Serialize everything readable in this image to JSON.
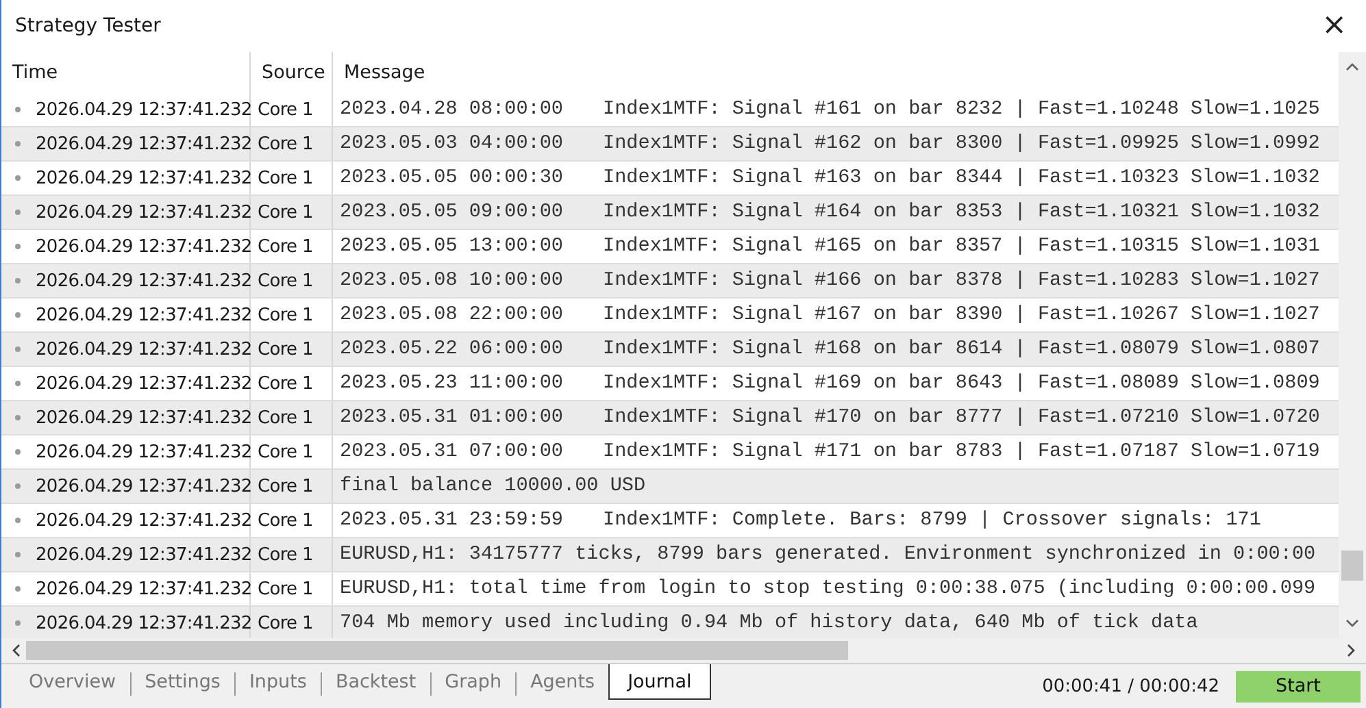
{
  "window": {
    "title": "Strategy Tester",
    "close": "×"
  },
  "table": {
    "columns": [
      "Time",
      "Source",
      "Message"
    ],
    "rows": [
      {
        "time": "2026.04.29 12:37:41.232",
        "source": "Core 1",
        "date": "2023.04.28 08:00:00",
        "text": "Index1MTF: Signal #161 on bar 8232 | Fast=1.10248 Slow=1.1025"
      },
      {
        "time": "2026.04.29 12:37:41.232",
        "source": "Core 1",
        "date": "2023.05.03 04:00:00",
        "text": "Index1MTF: Signal #162 on bar 8300 | Fast=1.09925 Slow=1.0992"
      },
      {
        "time": "2026.04.29 12:37:41.232",
        "source": "Core 1",
        "date": "2023.05.05 00:00:30",
        "text": "Index1MTF: Signal #163 on bar 8344 | Fast=1.10323 Slow=1.1032"
      },
      {
        "time": "2026.04.29 12:37:41.232",
        "source": "Core 1",
        "date": "2023.05.05 09:00:00",
        "text": "Index1MTF: Signal #164 on bar 8353 | Fast=1.10321 Slow=1.1032"
      },
      {
        "time": "2026.04.29 12:37:41.232",
        "source": "Core 1",
        "date": "2023.05.05 13:00:00",
        "text": "Index1MTF: Signal #165 on bar 8357 | Fast=1.10315 Slow=1.1031"
      },
      {
        "time": "2026.04.29 12:37:41.232",
        "source": "Core 1",
        "date": "2023.05.08 10:00:00",
        "text": "Index1MTF: Signal #166 on bar 8378 | Fast=1.10283 Slow=1.1027"
      },
      {
        "time": "2026.04.29 12:37:41.232",
        "source": "Core 1",
        "date": "2023.05.08 22:00:00",
        "text": "Index1MTF: Signal #167 on bar 8390 | Fast=1.10267 Slow=1.1027"
      },
      {
        "time": "2026.04.29 12:37:41.232",
        "source": "Core 1",
        "date": "2023.05.22 06:00:00",
        "text": "Index1MTF: Signal #168 on bar 8614 | Fast=1.08079 Slow=1.0807"
      },
      {
        "time": "2026.04.29 12:37:41.232",
        "source": "Core 1",
        "date": "2023.05.23 11:00:00",
        "text": "Index1MTF: Signal #169 on bar 8643 | Fast=1.08089 Slow=1.0809"
      },
      {
        "time": "2026.04.29 12:37:41.232",
        "source": "Core 1",
        "date": "2023.05.31 01:00:00",
        "text": "Index1MTF: Signal #170 on bar 8777 | Fast=1.07210 Slow=1.0720"
      },
      {
        "time": "2026.04.29 12:37:41.232",
        "source": "Core 1",
        "date": "2023.05.31 07:00:00",
        "text": "Index1MTF: Signal #171 on bar 8783 | Fast=1.07187 Slow=1.0719"
      },
      {
        "time": "2026.04.29 12:37:41.232",
        "source": "Core 1",
        "text": "final balance 10000.00 USD"
      },
      {
        "time": "2026.04.29 12:37:41.232",
        "source": "Core 1",
        "date": "2023.05.31 23:59:59",
        "text": "Index1MTF: Complete. Bars: 8799 | Crossover signals: 171"
      },
      {
        "time": "2026.04.29 12:37:41.232",
        "source": "Core 1",
        "text": "EURUSD,H1: 34175777 ticks, 8799 bars generated. Environment synchronized in 0:00:00"
      },
      {
        "time": "2026.04.29 12:37:41.232",
        "source": "Core 1",
        "text": "EURUSD,H1: total time from login to stop testing 0:00:38.075 (including 0:00:00.099"
      },
      {
        "time": "2026.04.29 12:37:41.232",
        "source": "Core 1",
        "text": "704 Mb memory used including 0.94 Mb of history data, 640 Mb of tick data"
      }
    ]
  },
  "tabs": [
    {
      "label": "Overview",
      "selected": false
    },
    {
      "label": "Settings",
      "selected": false
    },
    {
      "label": "Inputs",
      "selected": false
    },
    {
      "label": "Backtest",
      "selected": false
    },
    {
      "label": "Graph",
      "selected": false
    },
    {
      "label": "Agents",
      "selected": false
    },
    {
      "label": "Journal",
      "selected": true
    }
  ],
  "elapsed": "00:00:41 / 00:00:42",
  "start_button": "Start"
}
